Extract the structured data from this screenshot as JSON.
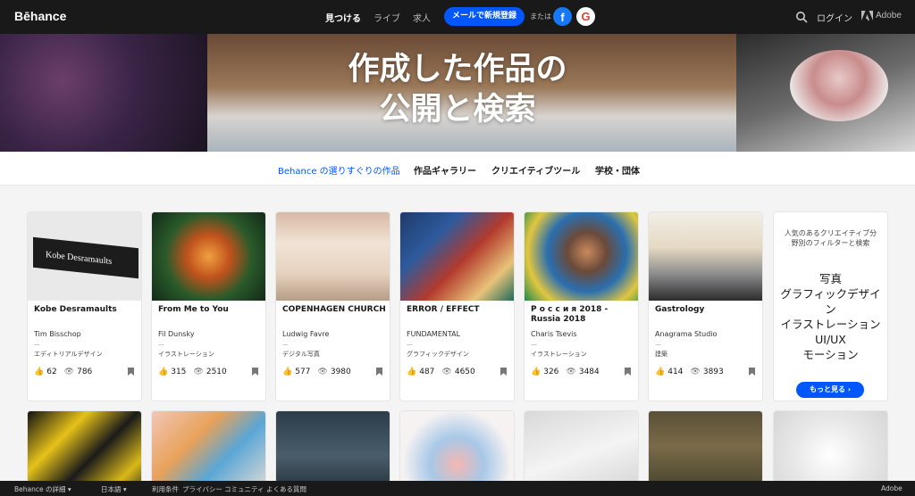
{
  "nav": {
    "logo": "Bēhance",
    "links": [
      "見つける",
      "ライブ",
      "求人"
    ],
    "signup": "メールで新規登録",
    "or": "または",
    "fb": "f",
    "google": "G",
    "login": "ログイン",
    "adobe": "Adobe"
  },
  "hero": {
    "line1": "作成した作品の",
    "line2": "公開と検索"
  },
  "subnav": [
    "Behance の選りすぐりの作品",
    "作品ギャラリー",
    "クリエイティブツール",
    "学校・団体"
  ],
  "cards": [
    {
      "title": "Kobe Desramaults",
      "owner": "Tim Bisschop",
      "dash": "—",
      "category": "エディトリアルデザイン",
      "likes": "62",
      "views": "786"
    },
    {
      "title": "From Me to You",
      "owner": "Fil Dunsky",
      "dash": "—",
      "category": "イラストレーション",
      "likes": "315",
      "views": "2510"
    },
    {
      "title": "COPENHAGEN CHURCH",
      "owner": "Ludwig Favre",
      "dash": "—",
      "category": "デジタル写真",
      "likes": "577",
      "views": "3980"
    },
    {
      "title": "ERROR / EFFECT",
      "owner": "FUNDAMENTAL",
      "dash": "—",
      "category": "グラフィックデザイン",
      "likes": "487",
      "views": "4650"
    },
    {
      "title": "Р о с с и я 2018 - Russia 2018",
      "owner": "Charis Tsevis",
      "dash": "—",
      "category": "イラストレーション",
      "likes": "326",
      "views": "3484"
    },
    {
      "title": "Gastrology",
      "owner": "Anagrama Studio",
      "dash": "—",
      "category": "建築",
      "likes": "414",
      "views": "3893"
    }
  ],
  "filter": {
    "intro": "人気のあるクリエイティブ分野別のフィルターと検索",
    "categories": [
      "写真",
      "グラフィックデザイン",
      "イラストレーション",
      "UI/UX",
      "モーション"
    ],
    "more": "もっと見る ›"
  },
  "thumb_label": "Kobe Desramaults",
  "footer": {
    "about": "Behance の詳細 ▾",
    "lang": "日本語 ▾",
    "links": [
      "利用条件",
      "プライバシー",
      "コミュニティ",
      "よくある質問"
    ],
    "adobe": "Adobe"
  }
}
